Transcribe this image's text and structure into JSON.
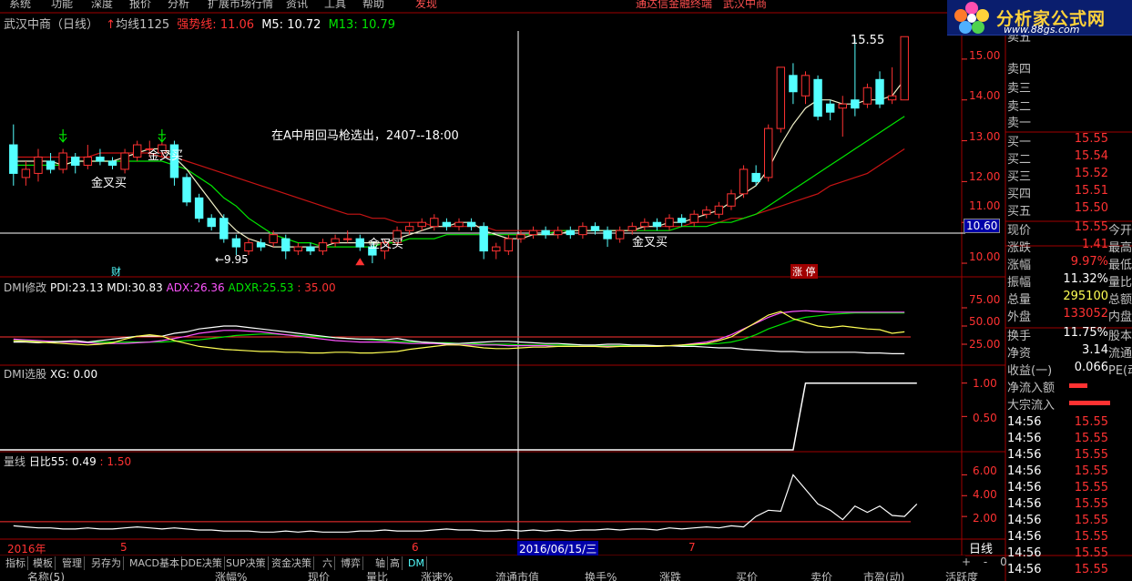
{
  "menu": {
    "items": [
      "系统",
      "功能",
      "深度",
      "报价",
      "分析",
      "扩展市场行情",
      "资讯",
      "工具",
      "帮助"
    ],
    "right_link": "发现",
    "center_text": "通达信金融终端",
    "stock_name_top": "武汉中商"
  },
  "logo": {
    "name": "分析家公式网",
    "url": "www.88gs.com"
  },
  "header": {
    "stock": "武汉中商（日线）",
    "ma_arrow": "↑",
    "ma_label": "均线1125",
    "strong_label": "强势线:",
    "strong_value": "11.06",
    "m5_label": "M5:",
    "m5_value": "10.72",
    "m13_label": "M13:",
    "m13_value": "10.79"
  },
  "annotations": {
    "note": "在A中用回马枪选出，2407--18:00",
    "golden_cross_1": "金叉买",
    "golden_cross_2": "金叉买",
    "golden_cross_3": "金叉买",
    "golden_cross_4": "金叉买",
    "low_label": "←9.95",
    "high_label": "15.55",
    "cai_marker": "财",
    "zhangting_marker": "涨 停",
    "cursor_price": "10.60",
    "cursor_date": "2016/06/15/三"
  },
  "price_axis": {
    "ticks": [
      "15.00",
      "14.00",
      "13.00",
      "12.00",
      "11.00",
      "10.00"
    ]
  },
  "dmi_panel": {
    "title": "DMI修改",
    "pdi_label": "PDI:",
    "pdi_value": "23.13",
    "mdi_label": "MDI:",
    "mdi_value": "30.83",
    "adx_label": "ADX:",
    "adx_value": "26.36",
    "adxr_label": "ADXR:",
    "adxr_value": "25.53",
    "sep": ":",
    "extra_value": "35.00",
    "ticks": [
      "75.00",
      "50.00",
      "25.00"
    ]
  },
  "xg_panel": {
    "title": "DMI选股",
    "xg_label": "XG:",
    "xg_value": "0.00",
    "ticks": [
      "1.00",
      "0.50"
    ]
  },
  "vol_panel": {
    "title": "量线",
    "ratio_label": "日比55:",
    "ratio_value": "0.49",
    "sep": ":",
    "extra_value": "1.50",
    "ticks": [
      "6.00",
      "4.00",
      "2.00"
    ]
  },
  "date_axis": {
    "year": "2016年",
    "m5": "5",
    "m6": "6",
    "m7": "7",
    "period": "日线"
  },
  "quote": {
    "asks": [
      {
        "label": "卖五"
      },
      {
        "label": "卖四"
      },
      {
        "label": "卖三"
      },
      {
        "label": "卖二"
      },
      {
        "label": "卖一"
      }
    ],
    "bids": [
      {
        "label": "买一",
        "value": "15.55"
      },
      {
        "label": "买二",
        "value": "15.54"
      },
      {
        "label": "买三",
        "value": "15.52"
      },
      {
        "label": "买四",
        "value": "15.51"
      },
      {
        "label": "买五",
        "value": "15.50"
      }
    ],
    "stats": [
      {
        "label": "现价",
        "value": "15.55",
        "extra": "今开"
      },
      {
        "label": "涨跌",
        "value": "1.41",
        "extra": "最高"
      },
      {
        "label": "涨幅",
        "value": "9.97%",
        "extra": "最低"
      },
      {
        "label": "振幅",
        "value": "11.32%",
        "extra": "量比"
      },
      {
        "label": "总量",
        "value": "295100",
        "extra": "总额"
      },
      {
        "label": "外盘",
        "value": "133052",
        "extra": "内盘"
      },
      {
        "label": "换手",
        "value": "11.75%",
        "extra": "股本"
      },
      {
        "label": "净资",
        "value": "3.14",
        "extra": "流通"
      },
      {
        "label": "收益(一)",
        "value": "0.066",
        "extra": "PE(动)"
      }
    ],
    "flows": [
      {
        "label": "净流入额"
      },
      {
        "label": "大宗流入"
      }
    ],
    "ticks": [
      {
        "time": "14:56",
        "price": "15.55"
      },
      {
        "time": "14:56",
        "price": "15.55"
      },
      {
        "time": "14:56",
        "price": "15.55"
      },
      {
        "time": "14:56",
        "price": "15.55"
      },
      {
        "time": "14:56",
        "price": "15.55"
      },
      {
        "time": "14:56",
        "price": "15.55"
      },
      {
        "time": "14:56",
        "price": "15.55"
      },
      {
        "time": "14:56",
        "price": "15.55"
      },
      {
        "time": "14:56",
        "price": "15.55"
      },
      {
        "time": "14:56",
        "price": "15.55"
      }
    ]
  },
  "bottom_tabs": [
    "指标",
    "模板",
    "管理",
    "另存为",
    "MACD基本",
    "DDE决策",
    "SUP决策",
    "资金决策",
    "六",
    "博弈",
    "轴",
    "高",
    "DM"
  ],
  "scroll_buttons": [
    "+",
    "-",
    "0"
  ],
  "column_header": [
    "名称(5)",
    "涨幅%",
    "现价",
    "量比",
    "涨速%",
    "流通市值",
    "换手%",
    "涨跌",
    "买价",
    "卖价",
    "市盈(动)",
    "活跃度"
  ],
  "colors": {
    "up": "#ff3232",
    "down": "#54ffff",
    "white": "#ffffff",
    "yellow": "#ffff54",
    "green": "#00e600",
    "magenta": "#ff54ff",
    "grid_red": "#a00000",
    "ma_red": "#c81414"
  },
  "chart_data": {
    "type": "candlestick",
    "price_ylim": [
      9.8,
      15.6
    ],
    "candles": [
      {
        "o": 12.9,
        "c": 12.2,
        "h": 13.4,
        "l": 11.9
      },
      {
        "o": 12.1,
        "c": 12.3,
        "h": 12.5,
        "l": 11.9
      },
      {
        "o": 12.2,
        "c": 12.6,
        "h": 12.8,
        "l": 12.0
      },
      {
        "o": 12.5,
        "c": 12.3,
        "h": 12.7,
        "l": 12.2
      },
      {
        "o": 12.3,
        "c": 12.7,
        "h": 12.8,
        "l": 12.2
      },
      {
        "o": 12.6,
        "c": 12.4,
        "h": 12.7,
        "l": 12.2
      },
      {
        "o": 12.4,
        "c": 12.6,
        "h": 12.9,
        "l": 12.3
      },
      {
        "o": 12.6,
        "c": 12.5,
        "h": 12.8,
        "l": 12.4
      },
      {
        "o": 12.5,
        "c": 12.4,
        "h": 12.6,
        "l": 12.3
      },
      {
        "o": 12.3,
        "c": 12.7,
        "h": 12.8,
        "l": 12.2
      },
      {
        "o": 12.6,
        "c": 12.9,
        "h": 13.0,
        "l": 12.5
      },
      {
        "o": 12.8,
        "c": 12.8,
        "h": 13.0,
        "l": 12.6
      },
      {
        "o": 12.7,
        "c": 12.9,
        "h": 13.0,
        "l": 12.6
      },
      {
        "o": 12.9,
        "c": 12.1,
        "h": 13.0,
        "l": 11.9
      },
      {
        "o": 12.1,
        "c": 11.5,
        "h": 12.2,
        "l": 11.4
      },
      {
        "o": 11.6,
        "c": 11.1,
        "h": 11.7,
        "l": 11.0
      },
      {
        "o": 11.1,
        "c": 10.9,
        "h": 11.2,
        "l": 10.8
      },
      {
        "o": 11.1,
        "c": 10.6,
        "h": 11.2,
        "l": 10.5
      },
      {
        "o": 10.6,
        "c": 10.4,
        "h": 10.7,
        "l": 10.2
      },
      {
        "o": 10.3,
        "c": 10.5,
        "h": 10.6,
        "l": 10.2
      },
      {
        "o": 10.5,
        "c": 10.4,
        "h": 10.6,
        "l": 10.3
      },
      {
        "o": 10.5,
        "c": 10.7,
        "h": 10.8,
        "l": 10.4
      },
      {
        "o": 10.6,
        "c": 10.3,
        "h": 10.7,
        "l": 10.1
      },
      {
        "o": 10.3,
        "c": 10.4,
        "h": 10.5,
        "l": 10.2
      },
      {
        "o": 10.4,
        "c": 10.3,
        "h": 10.5,
        "l": 10.2
      },
      {
        "o": 10.3,
        "c": 10.5,
        "h": 10.6,
        "l": 10.2
      },
      {
        "o": 10.5,
        "c": 10.6,
        "h": 10.7,
        "l": 10.4
      },
      {
        "o": 10.6,
        "c": 10.6,
        "h": 10.8,
        "l": 10.5
      },
      {
        "o": 10.6,
        "c": 10.4,
        "h": 10.7,
        "l": 10.3
      },
      {
        "o": 10.4,
        "c": 10.2,
        "h": 10.5,
        "l": 10.0
      },
      {
        "o": 10.3,
        "c": 10.5,
        "h": 10.6,
        "l": 10.1
      },
      {
        "o": 10.5,
        "c": 10.8,
        "h": 10.9,
        "l": 10.4
      },
      {
        "o": 10.8,
        "c": 10.9,
        "h": 11.0,
        "l": 10.7
      },
      {
        "o": 10.9,
        "c": 11.0,
        "h": 11.1,
        "l": 10.8
      },
      {
        "o": 10.9,
        "c": 11.1,
        "h": 11.2,
        "l": 10.8
      },
      {
        "o": 11.0,
        "c": 10.9,
        "h": 11.1,
        "l": 10.8
      },
      {
        "o": 10.9,
        "c": 11.0,
        "h": 11.1,
        "l": 10.8
      },
      {
        "o": 11.0,
        "c": 10.9,
        "h": 11.1,
        "l": 10.8
      },
      {
        "o": 10.9,
        "c": 10.3,
        "h": 11.0,
        "l": 10.1
      },
      {
        "o": 10.3,
        "c": 10.4,
        "h": 10.5,
        "l": 10.1
      },
      {
        "o": 10.3,
        "c": 10.6,
        "h": 10.7,
        "l": 10.2
      },
      {
        "o": 10.6,
        "c": 10.7,
        "h": 10.8,
        "l": 10.5
      },
      {
        "o": 10.7,
        "c": 10.8,
        "h": 10.9,
        "l": 10.6
      },
      {
        "o": 10.8,
        "c": 10.7,
        "h": 10.9,
        "l": 10.6
      },
      {
        "o": 10.7,
        "c": 10.8,
        "h": 10.9,
        "l": 10.6
      },
      {
        "o": 10.8,
        "c": 10.7,
        "h": 10.9,
        "l": 10.6
      },
      {
        "o": 10.7,
        "c": 10.9,
        "h": 11.0,
        "l": 10.6
      },
      {
        "o": 10.9,
        "c": 10.8,
        "h": 11.0,
        "l": 10.7
      },
      {
        "o": 10.8,
        "c": 10.6,
        "h": 10.9,
        "l": 10.4
      },
      {
        "o": 10.6,
        "c": 10.8,
        "h": 10.9,
        "l": 10.5
      },
      {
        "o": 10.8,
        "c": 10.9,
        "h": 11.0,
        "l": 10.7
      },
      {
        "o": 10.9,
        "c": 11.0,
        "h": 11.1,
        "l": 10.8
      },
      {
        "o": 11.0,
        "c": 10.9,
        "h": 11.1,
        "l": 10.8
      },
      {
        "o": 10.9,
        "c": 11.1,
        "h": 11.2,
        "l": 10.8
      },
      {
        "o": 11.1,
        "c": 11.0,
        "h": 11.2,
        "l": 10.9
      },
      {
        "o": 11.0,
        "c": 11.2,
        "h": 11.3,
        "l": 10.9
      },
      {
        "o": 11.2,
        "c": 11.3,
        "h": 11.4,
        "l": 11.1
      },
      {
        "o": 11.2,
        "c": 11.4,
        "h": 11.5,
        "l": 11.1
      },
      {
        "o": 11.4,
        "c": 11.7,
        "h": 11.8,
        "l": 11.3
      },
      {
        "o": 11.7,
        "c": 12.3,
        "h": 12.4,
        "l": 11.6
      },
      {
        "o": 12.2,
        "c": 12.0,
        "h": 12.4,
        "l": 11.9
      },
      {
        "o": 12.1,
        "c": 13.3,
        "h": 13.4,
        "l": 12.0
      },
      {
        "o": 13.3,
        "c": 14.8,
        "h": 14.8,
        "l": 13.2
      },
      {
        "o": 14.6,
        "c": 14.2,
        "h": 14.9,
        "l": 13.9
      },
      {
        "o": 14.1,
        "c": 14.6,
        "h": 14.7,
        "l": 13.9
      },
      {
        "o": 14.5,
        "c": 13.6,
        "h": 14.6,
        "l": 13.5
      },
      {
        "o": 13.9,
        "c": 13.7,
        "h": 14.0,
        "l": 13.5
      },
      {
        "o": 13.8,
        "c": 13.9,
        "h": 14.1,
        "l": 13.1
      },
      {
        "o": 14.0,
        "c": 13.8,
        "h": 15.5,
        "l": 13.6
      },
      {
        "o": 13.9,
        "c": 14.3,
        "h": 14.4,
        "l": 13.8
      },
      {
        "o": 14.5,
        "c": 13.9,
        "h": 14.7,
        "l": 13.8
      },
      {
        "o": 14.0,
        "c": 14.1,
        "h": 14.8,
        "l": 13.9
      },
      {
        "o": 14.0,
        "c": 15.55,
        "h": 15.55,
        "l": 14.0
      }
    ],
    "ma_white": [
      12.5,
      12.5,
      12.5,
      12.5,
      12.4,
      12.5,
      12.5,
      12.5,
      12.5,
      12.6,
      12.7,
      12.8,
      12.8,
      12.6,
      12.3,
      11.9,
      11.5,
      11.1,
      10.8,
      10.6,
      10.5,
      10.4,
      10.4,
      10.4,
      10.4,
      10.4,
      10.5,
      10.5,
      10.5,
      10.5,
      10.5,
      10.6,
      10.7,
      10.8,
      10.9,
      10.9,
      11.0,
      11.0,
      10.8,
      10.7,
      10.6,
      10.6,
      10.7,
      10.7,
      10.7,
      10.8,
      10.8,
      10.8,
      10.8,
      10.8,
      10.8,
      10.9,
      10.9,
      11.0,
      11.0,
      11.1,
      11.2,
      11.3,
      11.5,
      11.7,
      11.9,
      12.3,
      12.9,
      13.4,
      13.8,
      14.0,
      14.0,
      13.9,
      13.9,
      14.0,
      14.0,
      14.1,
      14.5
    ],
    "ma_green": [
      12.4,
      12.4,
      12.4,
      12.4,
      12.4,
      12.5,
      12.5,
      12.5,
      12.5,
      12.5,
      12.5,
      12.5,
      12.5,
      12.4,
      12.3,
      12.1,
      11.9,
      11.6,
      11.4,
      11.1,
      10.9,
      10.7,
      10.6,
      10.5,
      10.5,
      10.4,
      10.4,
      10.4,
      10.4,
      10.4,
      10.5,
      10.5,
      10.6,
      10.6,
      10.6,
      10.7,
      10.7,
      10.7,
      10.7,
      10.7,
      10.7,
      10.7,
      10.7,
      10.7,
      10.8,
      10.8,
      10.8,
      10.8,
      10.8,
      10.8,
      10.8,
      10.8,
      10.8,
      10.8,
      10.9,
      10.9,
      10.9,
      11.0,
      11.0,
      11.1,
      11.2,
      11.4,
      11.6,
      11.8,
      12.0,
      12.2,
      12.4,
      12.6,
      12.8,
      13.0,
      13.2,
      13.4,
      13.6
    ],
    "ma_red": [
      12.6,
      12.6,
      12.6,
      12.6,
      12.6,
      12.6,
      12.6,
      12.7,
      12.7,
      12.7,
      12.7,
      12.7,
      12.6,
      12.6,
      12.5,
      12.4,
      12.3,
      12.2,
      12.1,
      12.0,
      11.9,
      11.8,
      11.7,
      11.6,
      11.5,
      11.4,
      11.3,
      11.2,
      11.2,
      11.1,
      11.1,
      11.0,
      11.0,
      11.0,
      10.9,
      10.9,
      10.9,
      10.9,
      10.9,
      10.8,
      10.8,
      10.8,
      10.8,
      10.8,
      10.8,
      10.8,
      10.8,
      10.8,
      10.8,
      10.8,
      10.8,
      10.9,
      10.9,
      10.9,
      10.9,
      11.0,
      11.0,
      11.0,
      11.1,
      11.1,
      11.2,
      11.3,
      11.4,
      11.5,
      11.6,
      11.7,
      11.9,
      12.0,
      12.1,
      12.2,
      12.4,
      12.6,
      12.8
    ],
    "dmi": {
      "ylim": [
        0,
        100
      ],
      "pdi": [
        30,
        29,
        28,
        27,
        26,
        25,
        24,
        25,
        27,
        32,
        36,
        38,
        36,
        30,
        26,
        22,
        20,
        18,
        17,
        16,
        15,
        15,
        14,
        14,
        13,
        13,
        14,
        14,
        13,
        13,
        14,
        15,
        18,
        20,
        22,
        24,
        24,
        22,
        20,
        19,
        19,
        20,
        21,
        21,
        22,
        22,
        22,
        22,
        21,
        22,
        22,
        22,
        22,
        23,
        24,
        25,
        26,
        30,
        35,
        45,
        55,
        65,
        70,
        60,
        55,
        50,
        48,
        50,
        48,
        46,
        45,
        40,
        42
      ],
      "mdi": [
        28,
        28,
        27,
        28,
        29,
        30,
        28,
        30,
        32,
        34,
        36,
        36,
        36,
        40,
        42,
        46,
        48,
        50,
        50,
        48,
        46,
        44,
        42,
        40,
        38,
        36,
        34,
        33,
        32,
        32,
        31,
        33,
        30,
        28,
        27,
        26,
        26,
        27,
        28,
        29,
        29,
        28,
        27,
        26,
        26,
        25,
        24,
        24,
        25,
        25,
        24,
        24,
        23,
        23,
        22,
        22,
        21,
        20,
        20,
        18,
        17,
        16,
        15,
        15,
        14,
        14,
        14,
        14,
        14,
        13,
        13,
        12,
        12
      ],
      "adx": [
        32,
        31,
        30,
        29,
        28,
        28,
        27,
        26,
        26,
        26,
        27,
        28,
        30,
        33,
        36,
        40,
        42,
        44,
        44,
        43,
        42,
        40,
        38,
        36,
        34,
        32,
        30,
        29,
        28,
        28,
        28,
        27,
        26,
        26,
        26,
        25,
        24,
        24,
        24,
        24,
        23,
        23,
        23,
        23,
        22,
        22,
        22,
        22,
        22,
        22,
        22,
        22,
        22,
        23,
        24,
        26,
        28,
        32,
        38,
        46,
        54,
        62,
        68,
        70,
        71,
        70,
        69,
        69,
        69,
        69,
        69,
        69,
        69
      ],
      "adxr": [
        30,
        30,
        29,
        29,
        29,
        28,
        28,
        28,
        28,
        28,
        28,
        28,
        28,
        29,
        30,
        31,
        33,
        35,
        37,
        38,
        39,
        39,
        38,
        37,
        36,
        35,
        34,
        33,
        32,
        31,
        30,
        29,
        28,
        28,
        27,
        27,
        26,
        26,
        25,
        25,
        25,
        24,
        24,
        24,
        24,
        24,
        24,
        23,
        23,
        23,
        23,
        23,
        23,
        23,
        23,
        24,
        25,
        26,
        28,
        32,
        38,
        46,
        52,
        58,
        62,
        64,
        66,
        67,
        68,
        68,
        68,
        68,
        68
      ]
    },
    "xg": {
      "ylim": [
        0,
        1.2
      ],
      "values": [
        0,
        0,
        0,
        0,
        0,
        0,
        0,
        0,
        0,
        0,
        0,
        0,
        0,
        0,
        0,
        0,
        0,
        0,
        0,
        0,
        0,
        0,
        0,
        0,
        0,
        0,
        0,
        0,
        0,
        0,
        0,
        0,
        0,
        0,
        0,
        0,
        0,
        0,
        0,
        0,
        0,
        0,
        0,
        0,
        0,
        0,
        0,
        0,
        0,
        0,
        0,
        0,
        0,
        0,
        0,
        0,
        0,
        0,
        0,
        0,
        0,
        0,
        0,
        0,
        1,
        1,
        1,
        1,
        1,
        1,
        1,
        1,
        1,
        1
      ]
    },
    "volume_ratio": {
      "ylim": [
        0,
        7
      ],
      "values": [
        1.1,
        1.0,
        0.9,
        0.9,
        0.8,
        0.8,
        0.9,
        0.8,
        0.8,
        0.9,
        1.0,
        0.9,
        0.8,
        0.9,
        0.8,
        0.7,
        0.7,
        0.6,
        0.6,
        0.6,
        0.5,
        0.5,
        0.6,
        0.5,
        0.6,
        0.5,
        0.5,
        0.5,
        0.6,
        0.6,
        0.7,
        0.6,
        0.6,
        0.6,
        0.7,
        0.8,
        0.7,
        0.7,
        0.6,
        0.6,
        0.7,
        0.6,
        0.7,
        0.6,
        0.7,
        0.6,
        0.7,
        0.7,
        0.8,
        0.7,
        0.8,
        0.8,
        0.7,
        0.9,
        0.8,
        0.9,
        1.0,
        0.9,
        1.1,
        1.0,
        2.0,
        2.6,
        2.5,
        6.0,
        4.6,
        3.2,
        2.6,
        1.7,
        3.0,
        2.4,
        3.0,
        2.1,
        2.0,
        3.2
      ]
    }
  }
}
